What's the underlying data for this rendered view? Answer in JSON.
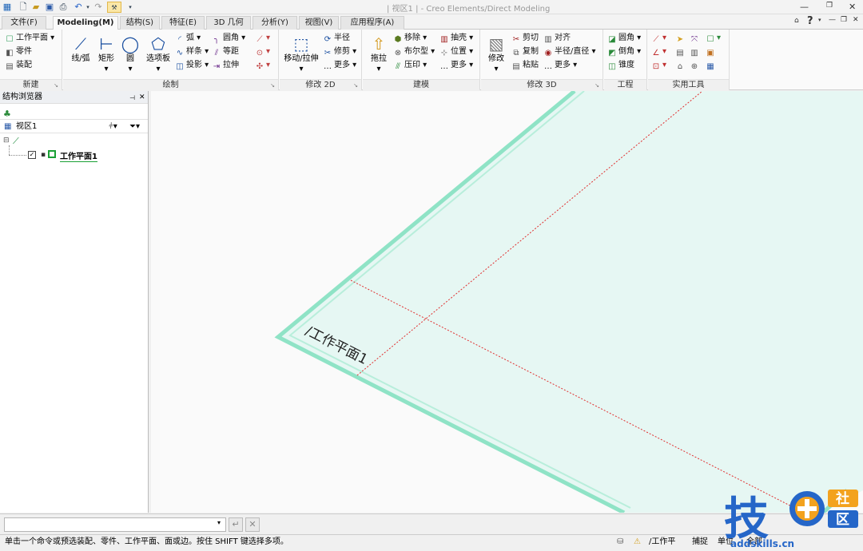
{
  "title_bar": {
    "title": "| 视区1 | - Creo Elements/Direct Modeling"
  },
  "ribbon_tabs": [
    {
      "label": "文件(F)"
    },
    {
      "label": "Modeling(M)"
    },
    {
      "label": "结构(S)"
    },
    {
      "label": "特征(E)"
    },
    {
      "label": "3D 几何"
    },
    {
      "label": "分析(Y)"
    },
    {
      "label": "视图(V)"
    },
    {
      "label": "应用程序(A)"
    }
  ],
  "groups": {
    "new": {
      "label": "新建",
      "items": [
        "工作平面",
        "零件",
        "装配"
      ]
    },
    "draw": {
      "label": "绘制",
      "big": [
        "线/弧",
        "矩形",
        "圆",
        "选项板"
      ],
      "col1": [
        "弧",
        "样条",
        "投影"
      ],
      "col2": [
        "圆角",
        "等距",
        "拉伸"
      ]
    },
    "modify2d": {
      "label": "修改 2D",
      "big": "移动/拉伸",
      "items": [
        "半径",
        "修剪",
        "更多"
      ]
    },
    "model": {
      "label": "建模",
      "big": "拖拉",
      "col1": [
        "移除",
        "布尔型",
        "压印"
      ],
      "col2": [
        "抽壳",
        "位置",
        "更多"
      ]
    },
    "modify3d": {
      "label": "修改 3D",
      "big": "修改",
      "col1": [
        "剪切",
        "复制",
        "粘贴"
      ],
      "col2": [
        "对齐",
        "半径/直径",
        "更多"
      ]
    },
    "engineering": {
      "label": "工程",
      "items": [
        "圆角",
        "倒角",
        "锥度"
      ]
    },
    "utilities": {
      "label": "实用工具"
    }
  },
  "structure_browser": {
    "title": "结构浏览器",
    "viewport_label": "视区1",
    "workplane_name": "工作平面1"
  },
  "viewport": {
    "workplane_label": "/工作平面1",
    "colors": {
      "plane_fill": "#e8f8f4",
      "plane_edge": "#8fe3c6",
      "axis_line": "#e03030"
    }
  },
  "status": {
    "message": "单击一个命令或预选装配、零件、工作平面、面或边。按住 SHIFT 键选择多项。",
    "workplane": "/工作平",
    "snap": "捕捉",
    "unit": "单位",
    "all": "全部"
  },
  "watermark": {
    "char": "技",
    "badge1": "社",
    "badge2": "区",
    "url": "addskills.cn"
  }
}
